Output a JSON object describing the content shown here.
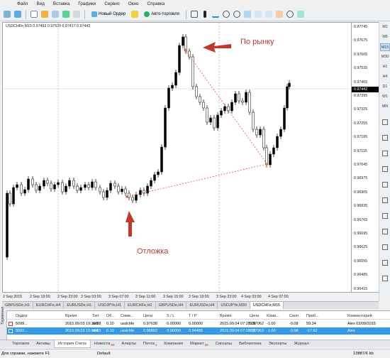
{
  "menu": [
    "Файл",
    "Вид",
    "Вставка",
    "Графики",
    "Сервис",
    "Окно",
    "Справка"
  ],
  "toolbar": {
    "new_order": "Новый Ордер",
    "autotrade": "Авто-торговля"
  },
  "chart": {
    "header": "USDCHFe,M15  0.97493 0.97520 0.97417 0.97442",
    "ylabels": [
      "0.97745",
      "0.97675",
      "0.97605",
      "0.97535",
      "0.97465",
      "0.97395",
      "0.97325",
      "0.97255",
      "0.97185",
      "0.97115",
      "0.97045",
      "0.96975",
      "0.96905",
      "0.96835",
      "0.96765",
      "0.96695",
      "0.96625",
      "0.96555",
      "0.96485",
      "0.96415"
    ],
    "current_price": "0.97442",
    "xlabels": [
      "2 Sep 2015",
      "2 Sep 19:00",
      "2 Sep 23:00",
      "3 Sep 03:00",
      "3 Sep 07:00",
      "3 Sep 11:00",
      "3 Sep 15:00",
      "3 Sep 19:00",
      "3 Sep 23:00",
      "4 Sep 03:00",
      "4 Sep 07:00"
    ],
    "annotation_market": "По рынку",
    "annotation_pending": "Отложка",
    "accent_red": "#c0392b"
  },
  "timeframes": [
    "M1",
    "M5",
    "M15",
    "M30",
    "H1",
    "H4",
    "D1",
    "W1",
    "MN"
  ],
  "chart_tabs": [
    "GBPUSDe,H1",
    "EURCHFe,H4",
    "EURUSDe,H1",
    "USDJPYe,H1",
    "EURCHFe,H1",
    "GBPUSDe,H4",
    "EURUSDe,H4",
    "USDJPYe,M30",
    "USDCHFe,M15"
  ],
  "terminal": {
    "side_label": "Терминал",
    "headers": [
      "Ордер",
      "Время",
      "Тип",
      "Об...",
      "Симв...",
      "Цена",
      "S / L",
      "T / P",
      "Время",
      "Цена",
      "Коми...",
      "Своп",
      "Приб...",
      "Комментарий"
    ],
    "rows": [
      [
        "5099...",
        "2015.09.03 19:30:38",
        "sell",
        "0.10",
        "usdchfe",
        "0.97638",
        "0.00000",
        "0.00000",
        "2015.09.04 07:28:26",
        "0.97062",
        "-1.00",
        "-0.08",
        "59.34",
        "Alex 03/09/2015"
      ],
      [
        "5093...",
        "2015.09.03 10:08:03",
        "sell",
        "0.10",
        "usdchfe",
        "0.96892",
        "0.00000",
        "0.94455",
        "2015.09.04 07:28:32",
        "0.97063",
        "-1.00",
        "-0.08",
        "-17.62",
        "Alex"
      ]
    ]
  },
  "bottom_tabs": [
    "Торговля",
    "Активы",
    "История Счета",
    "Новости",
    "Алерты",
    "Почта",
    "Компания",
    "Маркет",
    "Сигналы",
    "Библиотека",
    "Эксперты",
    "Журнал"
  ],
  "bottom_tab_badges": {
    "Новости": "99",
    "Почта": "1",
    "Маркет": "58"
  },
  "status": {
    "help": "Для справки, нажмите F1",
    "profile": "Default",
    "traffic": "13887/6 kb"
  }
}
